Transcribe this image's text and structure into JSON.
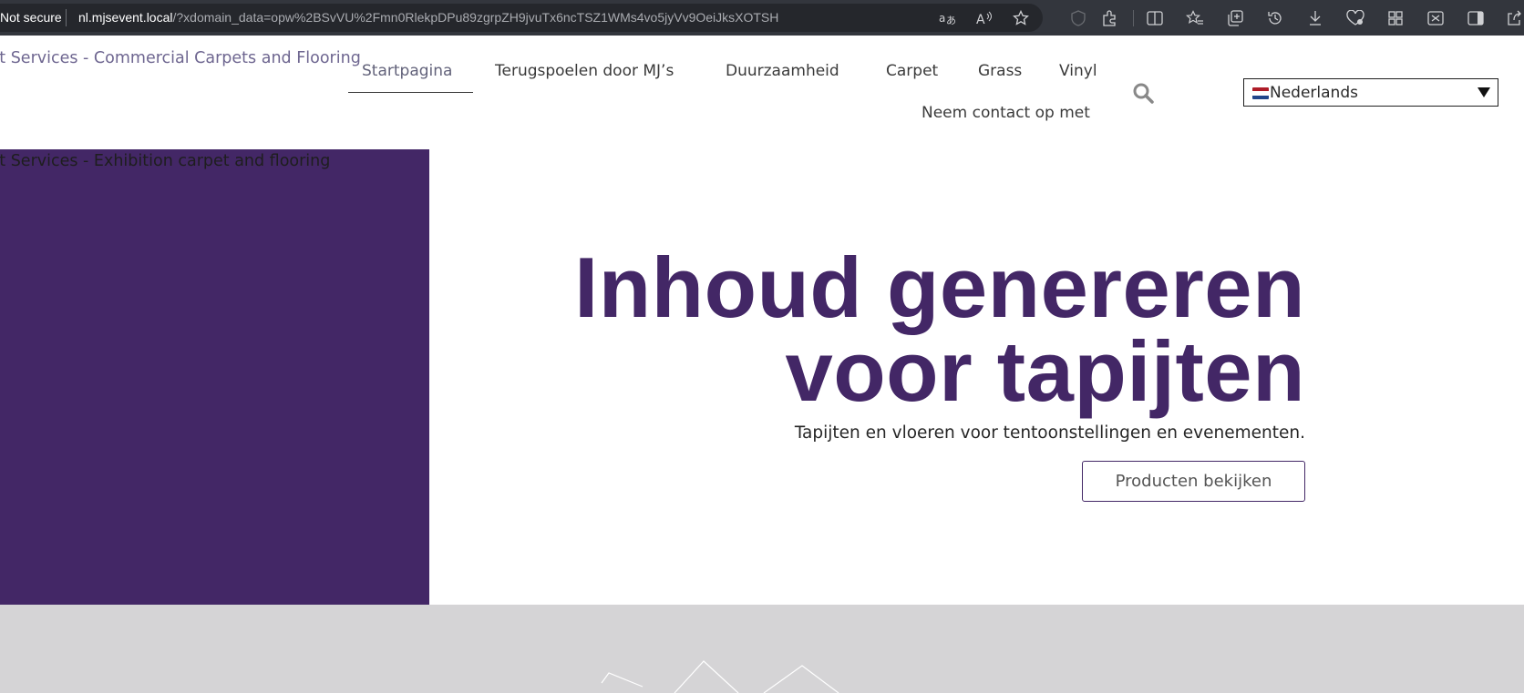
{
  "browser": {
    "security_label": "Not secure",
    "url_host": "nl.mjsevent.local",
    "url_path": "/?xdomain_data=opw%2BSvVU%2Fmn0RlekpDPu89zgrpZH9jvuTx6ncTSZ1WMs4vo5jyVv9OeiJksXOTSH",
    "icons": [
      "translate-icon",
      "read-aloud-icon",
      "favorite-star-icon",
      "extensions-icon",
      "split-screen-icon",
      "favorites-icon",
      "collections-icon",
      "history-icon",
      "downloads-icon",
      "performance-icon",
      "apps-icon",
      "screenshot-icon",
      "sidebar-icon",
      "share-icon"
    ]
  },
  "header": {
    "site_title": "Event Services - Commercial Carpets and Flooring",
    "nav": [
      {
        "label": "Startpagina",
        "active": true
      },
      {
        "label": "Terugspoelen door MJ’s"
      },
      {
        "label": "Duurzaamheid"
      },
      {
        "label": "Carpet"
      },
      {
        "label": "Grass"
      },
      {
        "label": "Vinyl"
      },
      {
        "label": "Neem contact op met"
      }
    ],
    "language": {
      "selected": "Nederlands"
    }
  },
  "hero": {
    "overlay_text": "Event Services - Exhibition carpet and flooring",
    "heading_line1": "Inhoud genereren",
    "heading_line2": "voor tapijten",
    "subtitle": "Tapijten en vloeren voor tentoonstellingen en evenementen.",
    "button_label": "Producten bekijken"
  },
  "colors": {
    "brand_purple": "#432766",
    "chrome_dark": "#33363d",
    "band_grey": "#d5d4d6"
  }
}
